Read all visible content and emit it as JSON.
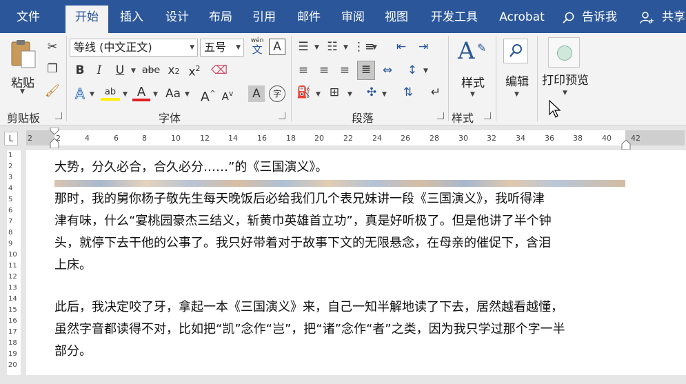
{
  "tabs": [
    {
      "label": "文件",
      "active": false
    },
    {
      "label": "开始",
      "active": true
    },
    {
      "label": "插入",
      "active": false
    },
    {
      "label": "设计",
      "active": false
    },
    {
      "label": "布局",
      "active": false
    },
    {
      "label": "引用",
      "active": false
    },
    {
      "label": "邮件",
      "active": false
    },
    {
      "label": "审阅",
      "active": false
    },
    {
      "label": "视图",
      "active": false
    },
    {
      "label": "开发工具",
      "active": false
    },
    {
      "label": "Acrobat",
      "active": false
    }
  ],
  "tell_me": "告诉我",
  "share": "共享",
  "ribbon": {
    "clipboard": {
      "label": "剪贴板",
      "paste": "粘贴"
    },
    "font": {
      "label": "字体",
      "font_name": "等线 (中文正文)",
      "font_size": "五号",
      "phonetic": "wén",
      "phonetic_char": "文"
    },
    "paragraph": {
      "label": "段落"
    },
    "styles": {
      "label": "样式",
      "button": "样式"
    },
    "editing": {
      "button": "编辑"
    },
    "print_preview": {
      "button": "打印预览"
    }
  },
  "ruler": {
    "h_ticks": [
      "2",
      "2",
      "4",
      "6",
      "8",
      "10",
      "12",
      "14",
      "16",
      "18",
      "20",
      "22",
      "24",
      "26",
      "28",
      "30",
      "32",
      "34",
      "36",
      "38",
      "40",
      "42"
    ],
    "v_ticks": [
      "1",
      "2",
      "3",
      "4",
      "5",
      "6",
      "7",
      "8",
      "9",
      "10",
      "11",
      "12",
      "13",
      "14",
      "15",
      "16",
      "17",
      "18",
      "19",
      "20"
    ]
  },
  "document": {
    "line0": "大势，分久必合，合久必分……”的《三国演义》。",
    "para1": [
      "那时，我的舅你杨子敬先生每天晚饭后必给我们几个表兄妹讲一段《三国演义》，我听得津",
      "津有味，什么“宴桃园豪杰三结义，斩黄巾英雄首立功”，真是好听极了。但是他讲了半个钟",
      "头，就停下去干他的公事了。我只好带着对于故事下文的无限悬念，在母亲的催促下，含泪",
      "上床。"
    ],
    "para2": [
      "此后，我决定咬了牙，拿起一本《三国演义》来，自己一知半解地读了下去，居然越看越懂，",
      "虽然字音都读得不对，比如把“凯”念作“岂”，把“诸”念作“者”之类，因为我只学过那个字一半",
      "部分。"
    ]
  }
}
